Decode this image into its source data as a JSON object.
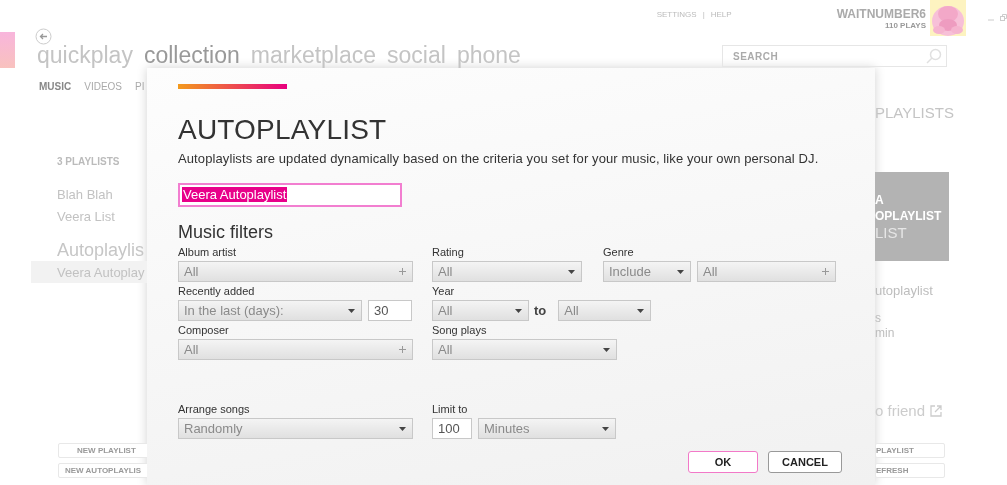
{
  "top_links": {
    "settings": "SETTINGS",
    "separator": "|",
    "help": "HELP"
  },
  "user": {
    "name": "WAITNUMBER6",
    "plays": "110 PLAYS"
  },
  "nav": [
    {
      "label": "quickplay",
      "selected": false
    },
    {
      "label": "collection",
      "selected": true
    },
    {
      "label": "marketplace",
      "selected": false
    },
    {
      "label": "social",
      "selected": false
    },
    {
      "label": "phone",
      "selected": false
    }
  ],
  "subnav": [
    {
      "label": "MUSIC",
      "selected": true
    },
    {
      "label": "VIDEOS",
      "selected": false
    },
    {
      "label": "PI",
      "selected": false
    }
  ],
  "search": {
    "placeholder": "SEARCH"
  },
  "sidebar": {
    "count": "3 PLAYLISTS",
    "playlists": [
      {
        "label": "Blah Blah",
        "selected": false
      },
      {
        "label": "Veera List",
        "selected": false
      }
    ],
    "autoplaylists_heading": "Autoplaylis",
    "autoplaylists": [
      {
        "label": "Veera Autoplay",
        "selected": true
      }
    ],
    "buttons": [
      "NEW PLAYLIST",
      "NEW AUTOPLAYLIS"
    ]
  },
  "detail": {
    "heading": "PLAYLISTS",
    "tile_title": [
      "A",
      "OPLAYLIST"
    ],
    "tile_subtitle": "LIST",
    "info": [
      "utoplaylist",
      "s",
      "min"
    ],
    "share_link": "o friend",
    "buttons": [
      "PLAYLIST",
      "EFRESH"
    ]
  },
  "dialog": {
    "title": "AUTOPLAYLIST",
    "description": "Autoplaylists are updated dynamically based on the criteria you set for your music, like your own personal DJ.",
    "name_value": "Veera Autoplaylist",
    "filters_heading": "Music filters",
    "rows": [
      [
        {
          "label": "Album artist",
          "controls": [
            {
              "kind": "multi",
              "value": "All"
            }
          ]
        },
        {
          "label": "Rating",
          "controls": [
            {
              "kind": "select",
              "value": "All"
            }
          ]
        },
        {
          "label": "Genre",
          "controls": [
            {
              "kind": "select",
              "value": "Include"
            },
            {
              "kind": "multi",
              "value": "All"
            }
          ]
        }
      ],
      [
        {
          "label": "Recently added",
          "controls": [
            {
              "kind": "select",
              "value": "In the last (days):"
            },
            {
              "kind": "text",
              "value": "30"
            }
          ]
        },
        {
          "label": "Year",
          "controls": [
            {
              "kind": "select",
              "value": "All"
            },
            {
              "kind": "word",
              "value": "to"
            },
            {
              "kind": "select",
              "value": "All"
            }
          ]
        }
      ],
      [
        {
          "label": "Composer",
          "controls": [
            {
              "kind": "multi",
              "value": "All"
            }
          ]
        },
        {
          "label": "Song plays",
          "controls": [
            {
              "kind": "select",
              "value": "All"
            }
          ]
        }
      ],
      [
        {
          "label": "Arrange songs",
          "controls": [
            {
              "kind": "select",
              "value": "Randomly"
            }
          ]
        },
        {
          "label": "Limit to",
          "controls": [
            {
              "kind": "text",
              "value": "100"
            },
            {
              "kind": "select",
              "value": "Minutes"
            }
          ]
        }
      ]
    ],
    "buttons": [
      {
        "label": "OK",
        "selected": true
      },
      {
        "label": "CANCEL",
        "selected": false
      }
    ]
  }
}
